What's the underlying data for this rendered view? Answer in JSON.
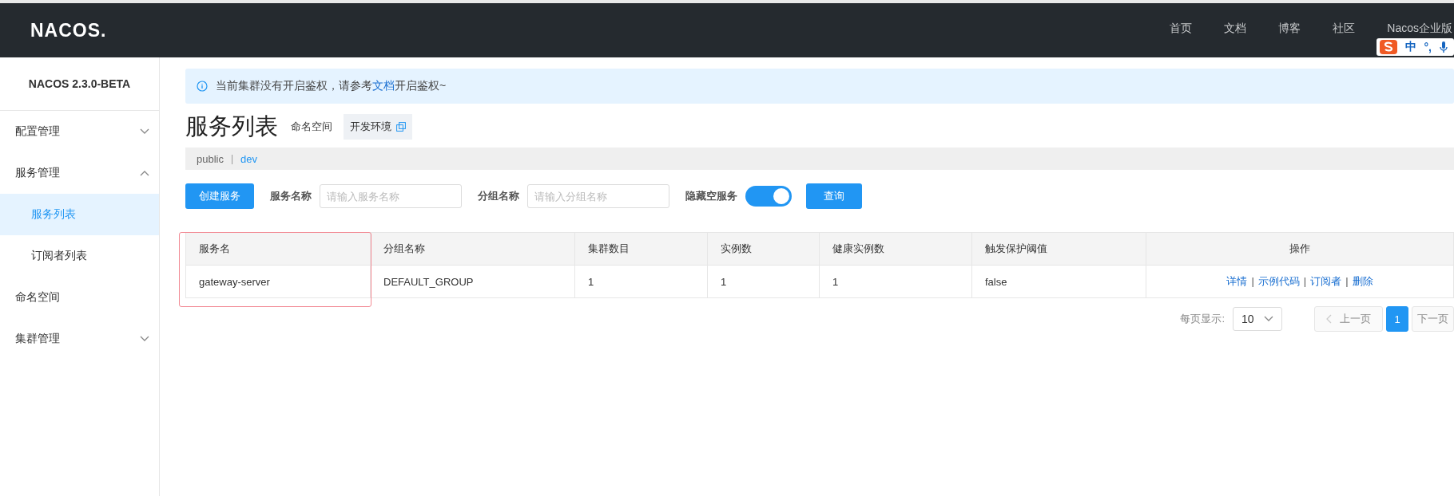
{
  "header": {
    "logo": "NACOS.",
    "nav": [
      {
        "label": "首页"
      },
      {
        "label": "文档"
      },
      {
        "label": "博客"
      },
      {
        "label": "社区"
      },
      {
        "label": "Nacos企业版"
      }
    ],
    "ime_toolbar": {
      "mode": "中",
      "punct": "°,"
    }
  },
  "sidebar": {
    "version": "NACOS 2.3.0-BETA",
    "items": [
      {
        "label": "配置管理",
        "expanded": false,
        "selected": false
      },
      {
        "label": "服务管理",
        "expanded": true,
        "selected": false,
        "children": [
          {
            "label": "服务列表",
            "selected": true
          },
          {
            "label": "订阅者列表",
            "selected": false
          }
        ]
      },
      {
        "label": "命名空间",
        "selected": false
      },
      {
        "label": "集群管理",
        "expanded": false,
        "selected": false
      }
    ]
  },
  "notice": {
    "before": "当前集群没有开启鉴权，请参考",
    "link": "文档",
    "after": "开启鉴权~"
  },
  "page": {
    "title": "服务列表",
    "namespace_label": "命名空间",
    "namespace_value": "开发环境"
  },
  "namespace_separator": "|",
  "namespaces": [
    {
      "label": "public",
      "selected": false
    },
    {
      "label": "dev",
      "selected": true
    }
  ],
  "toolbar": {
    "create_button": "创建服务",
    "service_name_label": "服务名称",
    "service_name_placeholder": "请输入服务名称",
    "group_name_label": "分组名称",
    "group_name_placeholder": "请输入分组名称",
    "hide_empty_label": "隐藏空服务",
    "hide_empty_on": true,
    "query_button": "查询"
  },
  "table": {
    "columns": [
      "服务名",
      "分组名称",
      "集群数目",
      "实例数",
      "健康实例数",
      "触发保护阈值",
      "操作"
    ],
    "rows": [
      {
        "cells": [
          "gateway-server",
          "DEFAULT_GROUP",
          "1",
          "1",
          "1",
          "false"
        ],
        "actions": [
          "详情",
          "示例代码",
          "订阅者",
          "删除"
        ],
        "action_separator": "|",
        "highlighted": true
      }
    ]
  },
  "pagination": {
    "page_size_label": "每页显示:",
    "page_size": "10",
    "prev": "上一页",
    "prev_disabled": true,
    "pages": [
      {
        "label": "1",
        "selected": true
      }
    ],
    "next": "下一页"
  }
}
